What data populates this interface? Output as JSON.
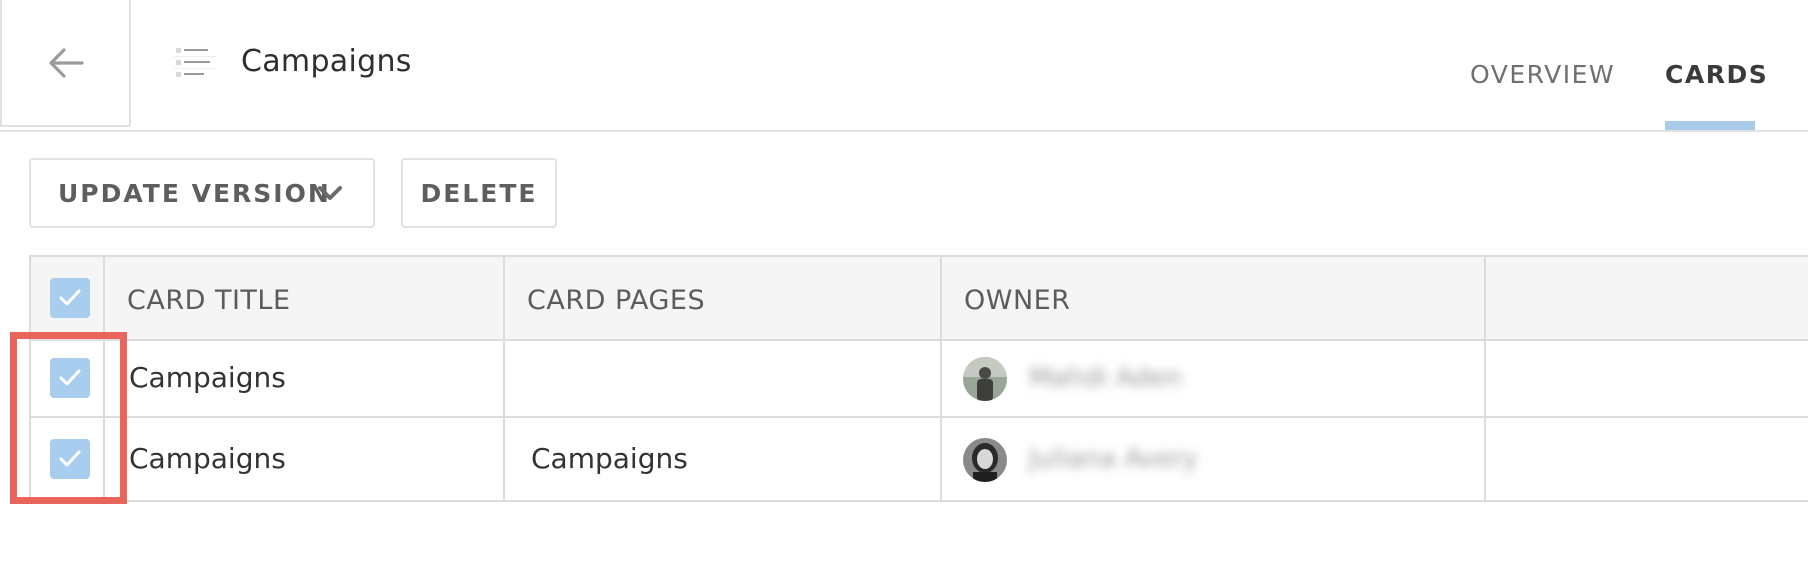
{
  "header": {
    "back_icon": "arrow-left-icon",
    "page_icon": "page-thumbnail-icon",
    "title": "Campaigns",
    "tabs": [
      {
        "label": "OVERVIEW",
        "active": false
      },
      {
        "label": "CARDS",
        "active": true
      }
    ],
    "active_tab_color": "#a9cbe7"
  },
  "toolbar": {
    "update_version_label": "UPDATE VERSION",
    "update_version_icon": "chevron-down-icon",
    "delete_label": "DELETE"
  },
  "table": {
    "columns": [
      "CARD TITLE",
      "CARD PAGES",
      "OWNER",
      ""
    ],
    "select_all_checked": true,
    "rows": [
      {
        "checked": true,
        "card_title": "Campaigns",
        "card_pages": "",
        "owner": "Mahdi Aden"
      },
      {
        "checked": true,
        "card_title": "Campaigns",
        "card_pages": "Campaigns",
        "owner": "Juliana Avery"
      }
    ],
    "checkbox_color": "#a8cdee"
  },
  "annotation": {
    "highlight_color": "#e9645a"
  }
}
